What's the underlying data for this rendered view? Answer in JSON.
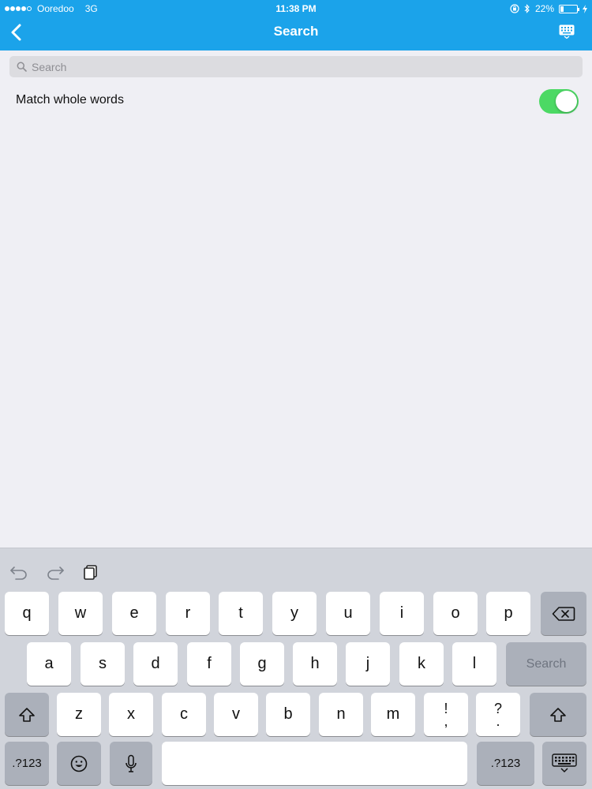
{
  "status_bar": {
    "carrier": "Ooredoo",
    "network": "3G",
    "time": "11:38 PM",
    "battery_percent": "22%",
    "battery_level": 0.22
  },
  "nav": {
    "title": "Search",
    "back_icon": "chevron-left-icon",
    "right_icon": "keyboard-icon"
  },
  "search": {
    "placeholder": "Search",
    "value": ""
  },
  "options": {
    "match_whole_words_label": "Match whole words",
    "match_whole_words_on": true
  },
  "keyboard": {
    "row1": [
      "q",
      "w",
      "e",
      "r",
      "t",
      "y",
      "u",
      "i",
      "o",
      "p"
    ],
    "row2": [
      "a",
      "s",
      "d",
      "f",
      "g",
      "h",
      "j",
      "k",
      "l"
    ],
    "row3": [
      "z",
      "x",
      "c",
      "v",
      "b",
      "n",
      "m"
    ],
    "punct1": [
      "!",
      ","
    ],
    "punct2": [
      "?",
      "."
    ],
    "search_key": "Search",
    "numbers_key": ".?123",
    "numbers_key_right": ".?123"
  },
  "colors": {
    "accent": "#1ba3ea",
    "toggle_on": "#4cd964",
    "background": "#efeff4"
  }
}
